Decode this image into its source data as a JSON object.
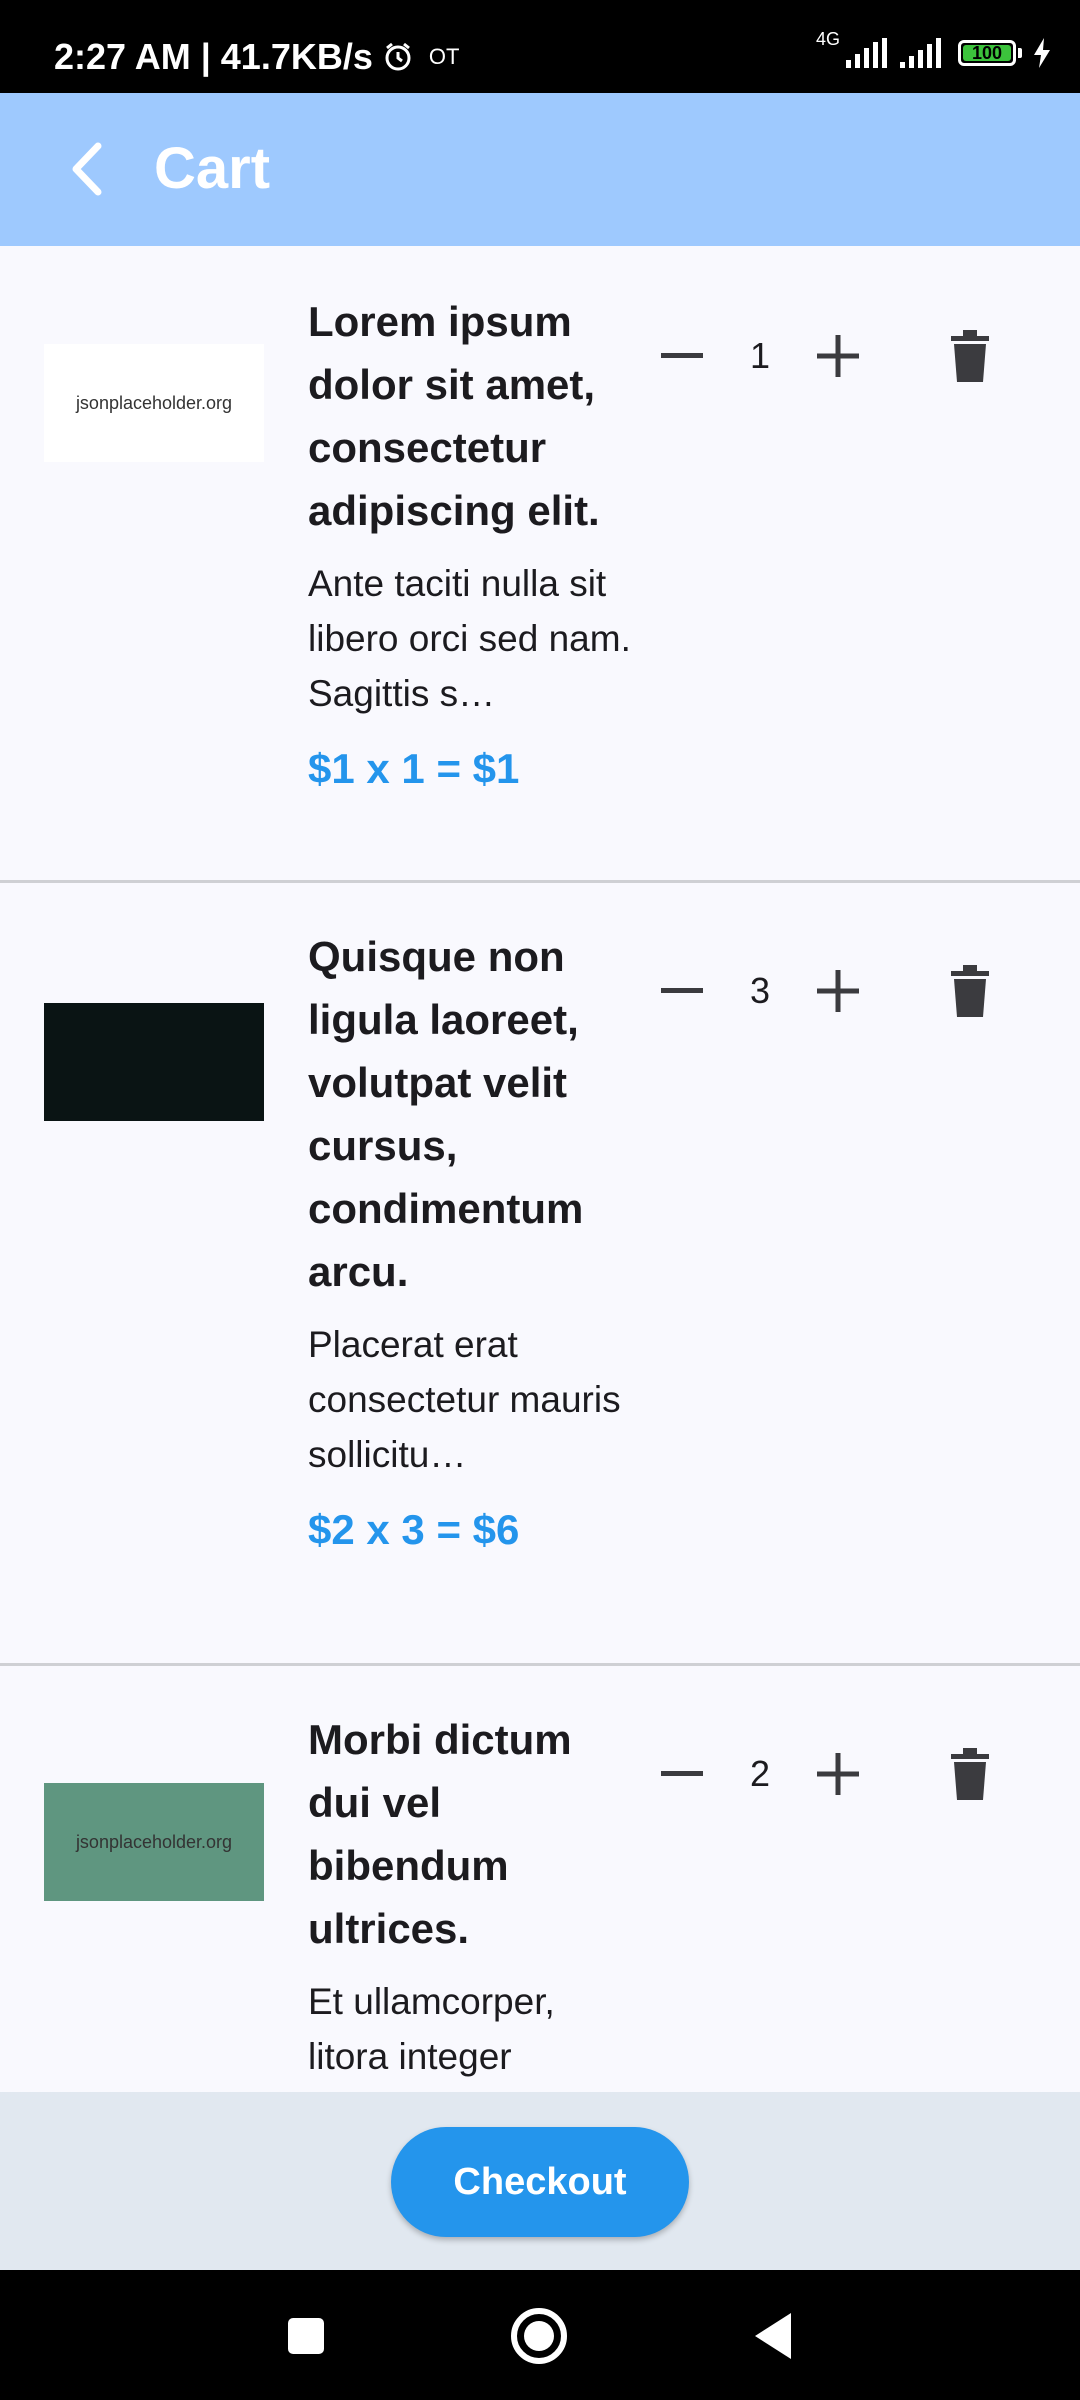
{
  "status_bar": {
    "time_speed": "2:27 AM | 41.7KB/s",
    "carrier_tag": "OT",
    "network": "4G",
    "battery": "100"
  },
  "appbar": {
    "title": "Cart"
  },
  "items": [
    {
      "thumb_text": "jsonplaceholder.org",
      "thumb_color": "#ffffff",
      "title": "Lorem ipsum dolor sit amet, consectetur adipiscing elit.",
      "description": "Ante taciti nulla sit libero orci sed nam. Sagittis s…",
      "price_line": "$1 x 1 = $1",
      "quantity": "1"
    },
    {
      "thumb_text": "",
      "thumb_color": "#0a1414",
      "title": "Quisque non ligula laoreet, volutpat velit cursus, condimentum arcu.",
      "description": "Placerat erat consectetur mauris sollicitu…",
      "price_line": "$2 x 3 = $6",
      "quantity": "3"
    },
    {
      "thumb_text": "jsonplaceholder.org",
      "thumb_color": "#5f9680",
      "title": "Morbi dictum dui vel bibendum ultrices.",
      "description": "Et ullamcorper, litora integer",
      "price_line": "",
      "quantity": "2"
    }
  ],
  "checkout": {
    "label": "Checkout"
  },
  "colors": {
    "accent": "#2495ec",
    "appbar": "#9ec9fe"
  }
}
